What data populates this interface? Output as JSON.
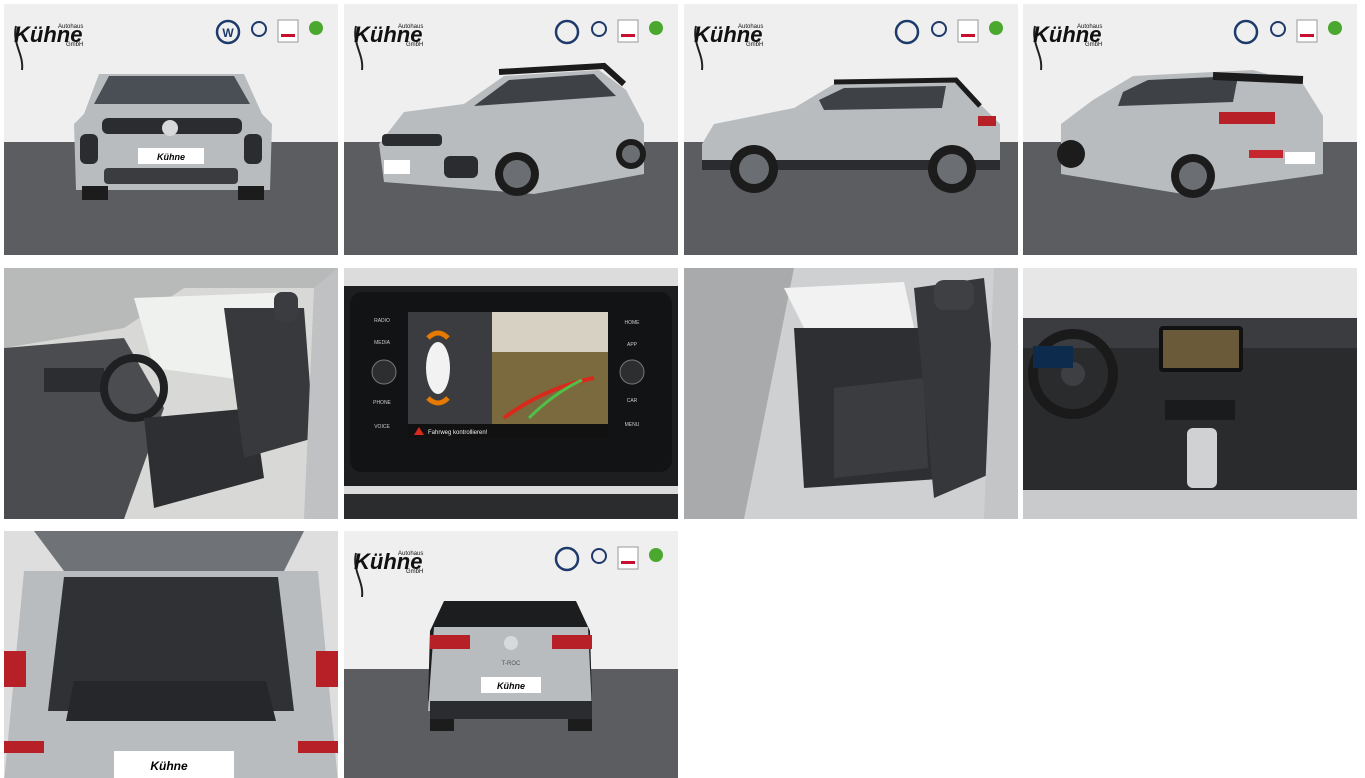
{
  "dealer": {
    "name": "Kühne",
    "tag_top": "Autohaus",
    "tag_bottom": "GmbH"
  },
  "plate_text": "Kühne",
  "model_badge": "T-ROC",
  "screen": {
    "left_buttons": [
      "RADIO",
      "MEDIA",
      "PHONE",
      "VOICE"
    ],
    "right_buttons": [
      "HOME",
      "APP",
      "CAR",
      "MENU"
    ],
    "warning": "Fahrweg kontrollieren!"
  },
  "photos": [
    {
      "label": "Front view"
    },
    {
      "label": "Front three-quarter view"
    },
    {
      "label": "Side view"
    },
    {
      "label": "Rear three-quarter view"
    },
    {
      "label": "Front seats"
    },
    {
      "label": "Infotainment screen with parking camera"
    },
    {
      "label": "Rear seats"
    },
    {
      "label": "Dashboard"
    },
    {
      "label": "Trunk"
    },
    {
      "label": "Rear view"
    }
  ],
  "colors": {
    "car_silver": "#b9bcbf",
    "studio_floor": "#5b5d60",
    "studio_wall": "#efefef"
  }
}
